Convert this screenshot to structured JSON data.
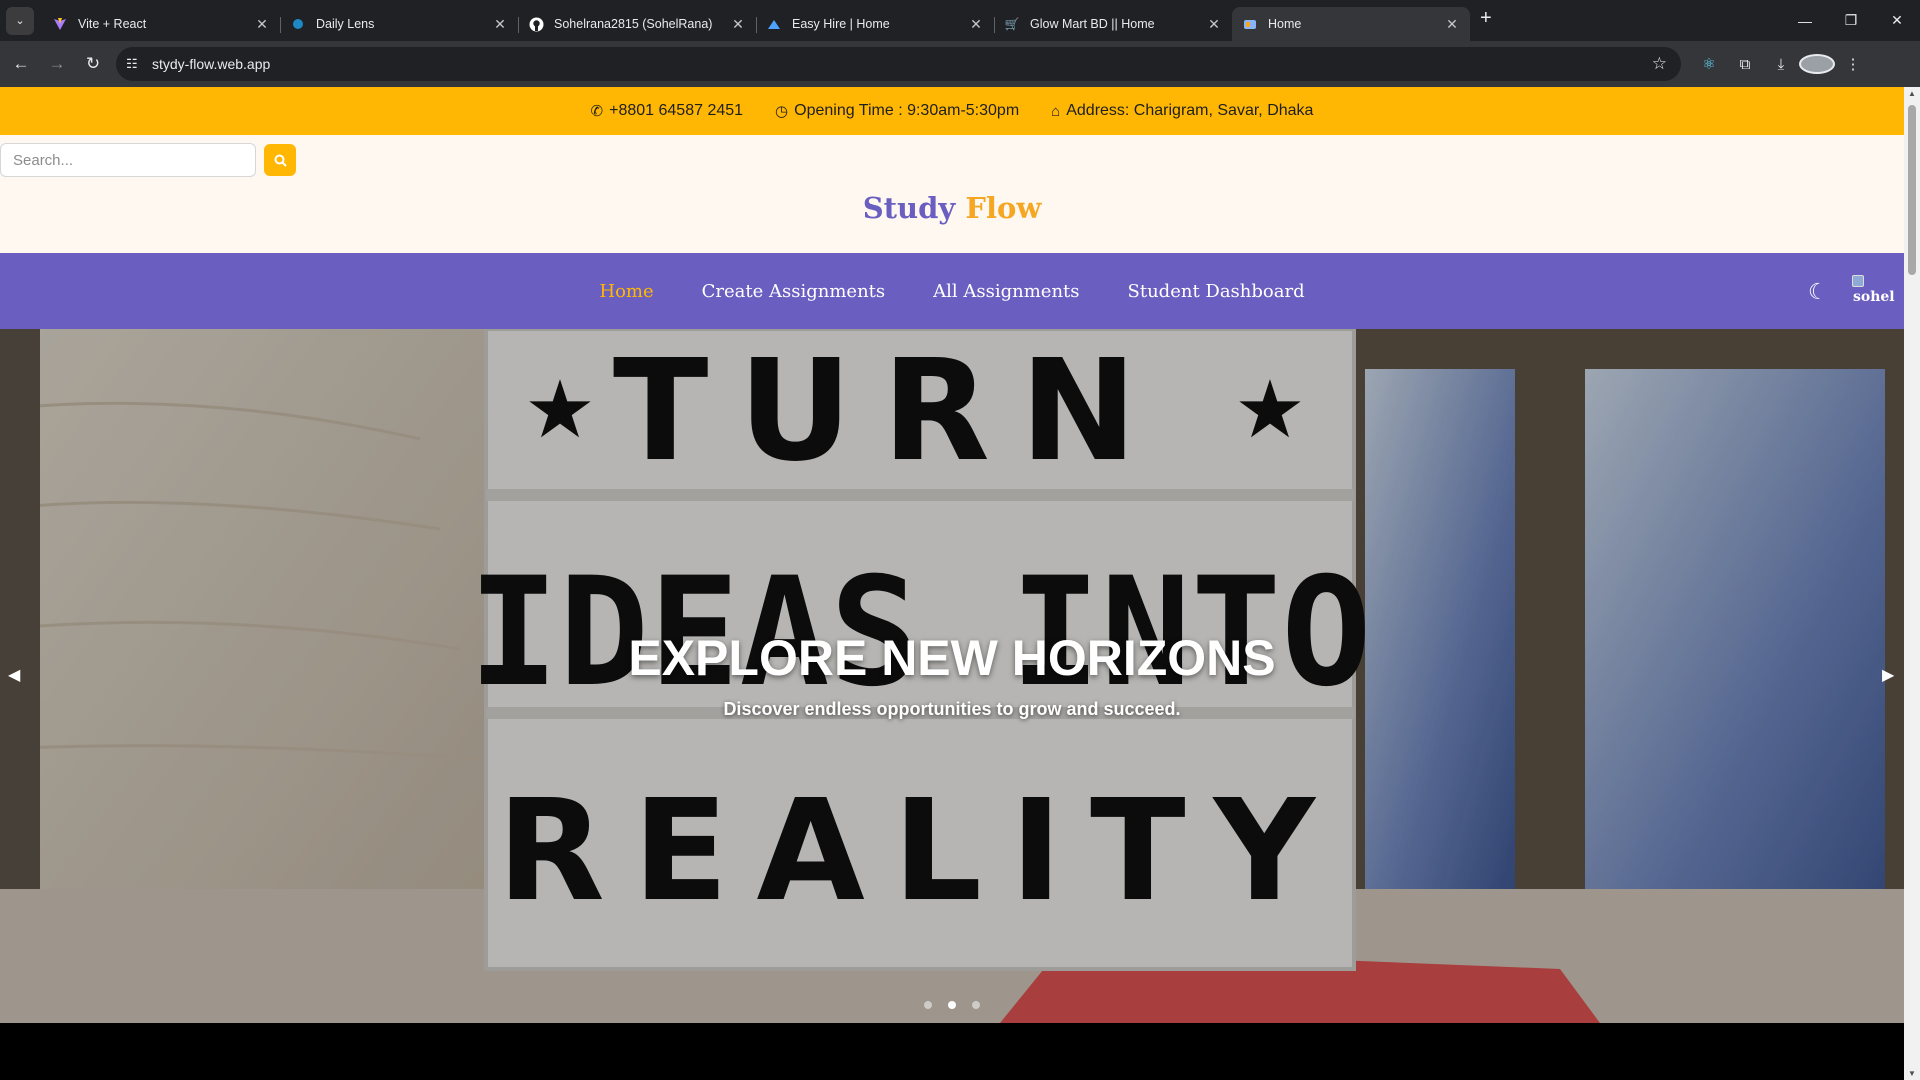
{
  "browser": {
    "tabs": [
      {
        "title": "Vite + React",
        "icon": "vite-icon",
        "active": false
      },
      {
        "title": "Daily Lens",
        "icon": "daily-lens-icon",
        "active": false
      },
      {
        "title": "Sohelrana2815 (SohelRana)",
        "icon": "github-icon",
        "active": false
      },
      {
        "title": "Easy Hire | Home",
        "icon": "easy-hire-icon",
        "active": false
      },
      {
        "title": "Glow Mart BD || Home",
        "icon": "cart-icon",
        "active": false
      },
      {
        "title": "Home",
        "icon": "study-flow-icon",
        "active": true
      }
    ],
    "url": "stydy-flow.web.app"
  },
  "topbar": {
    "phone": "+8801 64587 2451",
    "opening_time": "Opening Time : 9:30am-5:30pm",
    "address": "Address: Charigram, Savar, Dhaka"
  },
  "header": {
    "search_placeholder": "Search...",
    "logo_part1": "Study",
    "logo_part2": "Flow"
  },
  "nav": {
    "items": [
      "Home",
      "Create Assignments",
      "All Assignments",
      "Student Dashboard"
    ],
    "active": "Home",
    "avatar_alt": "sohel"
  },
  "hero": {
    "title": "EXPLORE NEW HORIZONS",
    "subtitle": "Discover endless opportunities to grow and succeed.",
    "slide_count": 3,
    "active_slide": 2,
    "lightbox_lines": [
      "TURN",
      "IDEAS INTO",
      "REALITY"
    ]
  },
  "colors": {
    "accent_yellow": "#ffb703",
    "primary_purple": "#6a5fc1",
    "header_bg": "#fff8f0"
  }
}
